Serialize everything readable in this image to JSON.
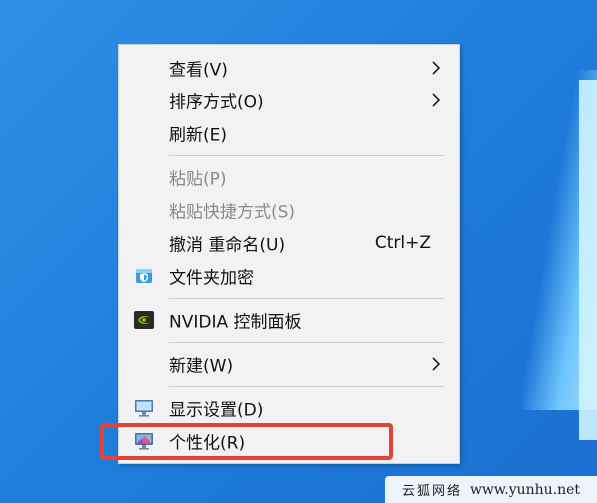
{
  "menu": {
    "items": [
      {
        "label": "查看(V)",
        "has_submenu": true
      },
      {
        "label": "排序方式(O)",
        "has_submenu": true
      },
      {
        "label": "刷新(E)"
      },
      {
        "label": "粘贴(P)",
        "disabled": true
      },
      {
        "label": "粘贴快捷方式(S)",
        "disabled": true
      },
      {
        "label": "撤消 重命名(U)",
        "shortcut": "Ctrl+Z"
      },
      {
        "label": "文件夹加密",
        "icon": "shield-folder-icon"
      },
      {
        "label": "NVIDIA 控制面板",
        "icon": "nvidia-icon"
      },
      {
        "label": "新建(W)",
        "has_submenu": true
      },
      {
        "label": "显示设置(D)",
        "icon": "monitor-icon"
      },
      {
        "label": "个性化(R)",
        "icon": "personalize-monitor-icon",
        "highlighted": true
      }
    ]
  },
  "watermark": {
    "cn": "云狐网络",
    "url": "www.yunhu.net"
  },
  "colors": {
    "desktop_bg": "#1f7fdc",
    "menu_bg": "#f2f2f2",
    "highlight": "#e04538"
  }
}
